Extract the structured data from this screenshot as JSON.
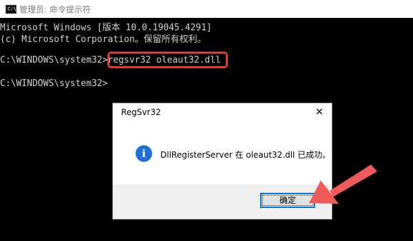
{
  "window": {
    "icon_glyph": "C:\\",
    "title": "管理员: 命令提示符"
  },
  "console": {
    "lines": [
      "Microsoft Windows [版本 10.0.19045.4291]",
      "(c) Microsoft Corporation。保留所有权利。",
      "",
      "C:\\WINDOWS\\system32>regsvr32 oleaut32.dll",
      "",
      "C:\\WINDOWS\\system32>"
    ]
  },
  "dialog": {
    "title": "RegSvr32",
    "close_glyph": "✕",
    "info_glyph": "i",
    "message": "DllRegisterServer 在 oleaut32.dll 已成功。",
    "ok_label": "确定"
  },
  "colors": {
    "highlight": "#e53935",
    "arrow": "#f05a5a",
    "info_blue": "#1f6fd6",
    "button_focus": "#0078d7"
  }
}
